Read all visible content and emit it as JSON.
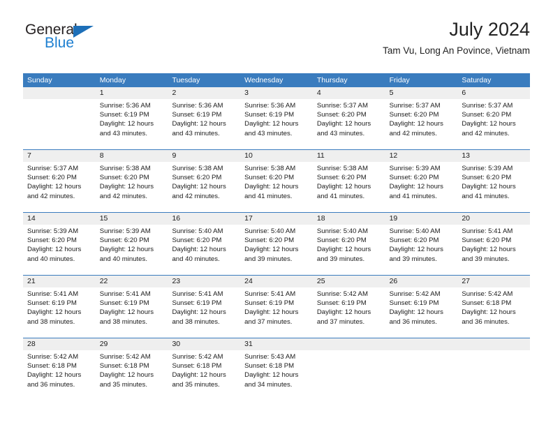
{
  "logo": {
    "word_one": "General",
    "word_two": "Blue",
    "triangle_icon": "triangle-icon",
    "accent_dark": "#231f20",
    "accent_blue": "#1d7fd0"
  },
  "header": {
    "title": "July 2024",
    "subtitle": "Tam Vu, Long An Povince, Vietnam"
  },
  "calendar": {
    "header_bg": "#3a7cbe",
    "day_band_bg": "#efefef",
    "weekdays": [
      "Sunday",
      "Monday",
      "Tuesday",
      "Wednesday",
      "Thursday",
      "Friday",
      "Saturday"
    ],
    "weeks": [
      [
        {
          "day": "",
          "lines": []
        },
        {
          "day": "1",
          "lines": [
            "Sunrise: 5:36 AM",
            "Sunset: 6:19 PM",
            "Daylight: 12 hours",
            "and 43 minutes."
          ]
        },
        {
          "day": "2",
          "lines": [
            "Sunrise: 5:36 AM",
            "Sunset: 6:19 PM",
            "Daylight: 12 hours",
            "and 43 minutes."
          ]
        },
        {
          "day": "3",
          "lines": [
            "Sunrise: 5:36 AM",
            "Sunset: 6:19 PM",
            "Daylight: 12 hours",
            "and 43 minutes."
          ]
        },
        {
          "day": "4",
          "lines": [
            "Sunrise: 5:37 AM",
            "Sunset: 6:20 PM",
            "Daylight: 12 hours",
            "and 43 minutes."
          ]
        },
        {
          "day": "5",
          "lines": [
            "Sunrise: 5:37 AM",
            "Sunset: 6:20 PM",
            "Daylight: 12 hours",
            "and 42 minutes."
          ]
        },
        {
          "day": "6",
          "lines": [
            "Sunrise: 5:37 AM",
            "Sunset: 6:20 PM",
            "Daylight: 12 hours",
            "and 42 minutes."
          ]
        }
      ],
      [
        {
          "day": "7",
          "lines": [
            "Sunrise: 5:37 AM",
            "Sunset: 6:20 PM",
            "Daylight: 12 hours",
            "and 42 minutes."
          ]
        },
        {
          "day": "8",
          "lines": [
            "Sunrise: 5:38 AM",
            "Sunset: 6:20 PM",
            "Daylight: 12 hours",
            "and 42 minutes."
          ]
        },
        {
          "day": "9",
          "lines": [
            "Sunrise: 5:38 AM",
            "Sunset: 6:20 PM",
            "Daylight: 12 hours",
            "and 42 minutes."
          ]
        },
        {
          "day": "10",
          "lines": [
            "Sunrise: 5:38 AM",
            "Sunset: 6:20 PM",
            "Daylight: 12 hours",
            "and 41 minutes."
          ]
        },
        {
          "day": "11",
          "lines": [
            "Sunrise: 5:38 AM",
            "Sunset: 6:20 PM",
            "Daylight: 12 hours",
            "and 41 minutes."
          ]
        },
        {
          "day": "12",
          "lines": [
            "Sunrise: 5:39 AM",
            "Sunset: 6:20 PM",
            "Daylight: 12 hours",
            "and 41 minutes."
          ]
        },
        {
          "day": "13",
          "lines": [
            "Sunrise: 5:39 AM",
            "Sunset: 6:20 PM",
            "Daylight: 12 hours",
            "and 41 minutes."
          ]
        }
      ],
      [
        {
          "day": "14",
          "lines": [
            "Sunrise: 5:39 AM",
            "Sunset: 6:20 PM",
            "Daylight: 12 hours",
            "and 40 minutes."
          ]
        },
        {
          "day": "15",
          "lines": [
            "Sunrise: 5:39 AM",
            "Sunset: 6:20 PM",
            "Daylight: 12 hours",
            "and 40 minutes."
          ]
        },
        {
          "day": "16",
          "lines": [
            "Sunrise: 5:40 AM",
            "Sunset: 6:20 PM",
            "Daylight: 12 hours",
            "and 40 minutes."
          ]
        },
        {
          "day": "17",
          "lines": [
            "Sunrise: 5:40 AM",
            "Sunset: 6:20 PM",
            "Daylight: 12 hours",
            "and 39 minutes."
          ]
        },
        {
          "day": "18",
          "lines": [
            "Sunrise: 5:40 AM",
            "Sunset: 6:20 PM",
            "Daylight: 12 hours",
            "and 39 minutes."
          ]
        },
        {
          "day": "19",
          "lines": [
            "Sunrise: 5:40 AM",
            "Sunset: 6:20 PM",
            "Daylight: 12 hours",
            "and 39 minutes."
          ]
        },
        {
          "day": "20",
          "lines": [
            "Sunrise: 5:41 AM",
            "Sunset: 6:20 PM",
            "Daylight: 12 hours",
            "and 39 minutes."
          ]
        }
      ],
      [
        {
          "day": "21",
          "lines": [
            "Sunrise: 5:41 AM",
            "Sunset: 6:19 PM",
            "Daylight: 12 hours",
            "and 38 minutes."
          ]
        },
        {
          "day": "22",
          "lines": [
            "Sunrise: 5:41 AM",
            "Sunset: 6:19 PM",
            "Daylight: 12 hours",
            "and 38 minutes."
          ]
        },
        {
          "day": "23",
          "lines": [
            "Sunrise: 5:41 AM",
            "Sunset: 6:19 PM",
            "Daylight: 12 hours",
            "and 38 minutes."
          ]
        },
        {
          "day": "24",
          "lines": [
            "Sunrise: 5:41 AM",
            "Sunset: 6:19 PM",
            "Daylight: 12 hours",
            "and 37 minutes."
          ]
        },
        {
          "day": "25",
          "lines": [
            "Sunrise: 5:42 AM",
            "Sunset: 6:19 PM",
            "Daylight: 12 hours",
            "and 37 minutes."
          ]
        },
        {
          "day": "26",
          "lines": [
            "Sunrise: 5:42 AM",
            "Sunset: 6:19 PM",
            "Daylight: 12 hours",
            "and 36 minutes."
          ]
        },
        {
          "day": "27",
          "lines": [
            "Sunrise: 5:42 AM",
            "Sunset: 6:18 PM",
            "Daylight: 12 hours",
            "and 36 minutes."
          ]
        }
      ],
      [
        {
          "day": "28",
          "lines": [
            "Sunrise: 5:42 AM",
            "Sunset: 6:18 PM",
            "Daylight: 12 hours",
            "and 36 minutes."
          ]
        },
        {
          "day": "29",
          "lines": [
            "Sunrise: 5:42 AM",
            "Sunset: 6:18 PM",
            "Daylight: 12 hours",
            "and 35 minutes."
          ]
        },
        {
          "day": "30",
          "lines": [
            "Sunrise: 5:42 AM",
            "Sunset: 6:18 PM",
            "Daylight: 12 hours",
            "and 35 minutes."
          ]
        },
        {
          "day": "31",
          "lines": [
            "Sunrise: 5:43 AM",
            "Sunset: 6:18 PM",
            "Daylight: 12 hours",
            "and 34 minutes."
          ]
        },
        {
          "day": "",
          "lines": []
        },
        {
          "day": "",
          "lines": []
        },
        {
          "day": "",
          "lines": []
        }
      ]
    ]
  }
}
